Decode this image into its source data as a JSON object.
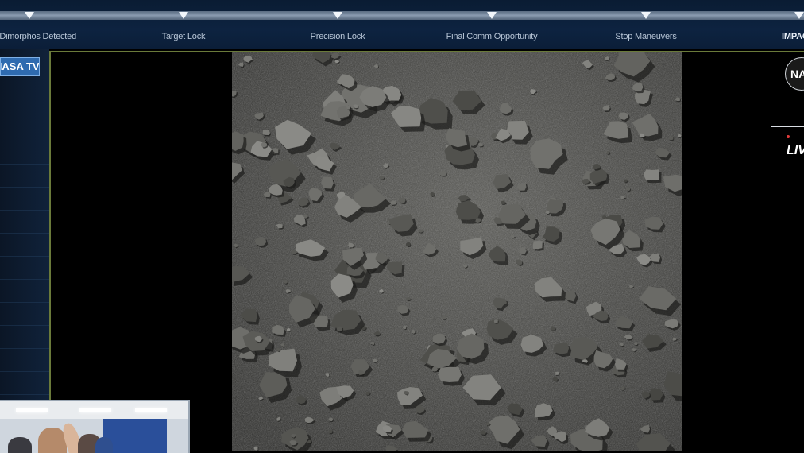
{
  "timeline": {
    "milestones": [
      {
        "label": "Didymos/Dimorphos Detected"
      },
      {
        "label": "Target Lock"
      },
      {
        "label": "Precision Lock"
      },
      {
        "label": "Final Comm Opportunity"
      },
      {
        "label": "Stop Maneuvers"
      },
      {
        "label": "IMPACT"
      }
    ]
  },
  "broadcast": {
    "channel_badge": "NASA TV",
    "logo_text": "NASA",
    "live_label": "LIVE"
  },
  "colors": {
    "timeline_bg": "#0d2340",
    "badge_bg": "#2f6bb0",
    "live_dot": "#e23b3b"
  }
}
